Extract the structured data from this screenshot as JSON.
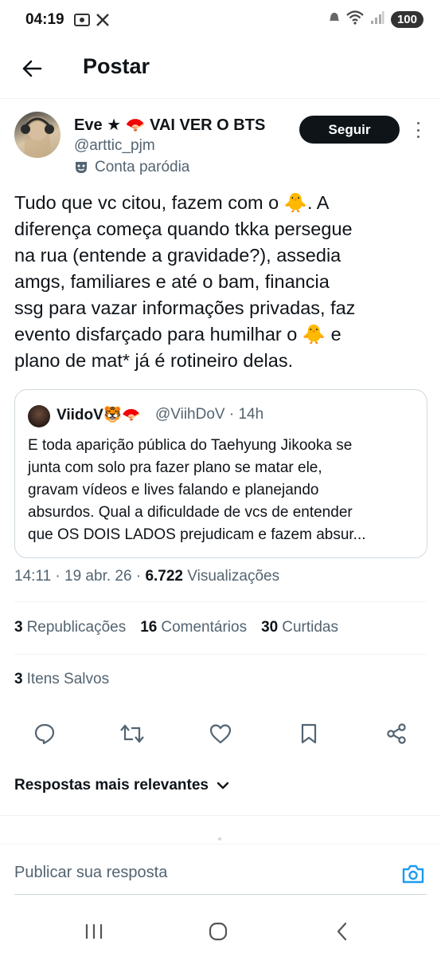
{
  "status_bar": {
    "time": "04:19",
    "battery": "100",
    "left_icons": [
      "screenshot-icon",
      "x-logo-icon"
    ],
    "right_icons": [
      "alarm-icon",
      "wifi-icon",
      "signal-icon"
    ]
  },
  "header": {
    "title": "Postar",
    "back_icon": "arrow-left-icon"
  },
  "post": {
    "author_name": "Eve ★ 🪭 VAI VER O BTS",
    "author_handle": "@arttic_pjm",
    "parody_label": "Conta paródia",
    "follow_label": "Seguir",
    "text_lines": [
      "Tudo que vc citou, fazem com o 🐥. A",
      "diferença começa quando tkka persegue",
      "na rua (entende a gravidade?), assedia",
      "amgs, familiares e até o bam, financia",
      "ssg para vazar informações privadas, faz",
      "evento disfarçado para humilhar o 🐥 e",
      "plano de mat* já é rotineiro delas."
    ],
    "quote": {
      "name": "ViidoV🐯🪭",
      "handle_time": "@ViihDoV · 14h",
      "text_lines": [
        "E toda aparição pública do Taehyung Jikooka se",
        "junta com solo pra fazer plano se matar ele,",
        "gravam vídeos e lives falando e planejando",
        "absurdos. Qual a dificuldade de vcs de entender",
        "que OS DOIS LADOS prejudicam e fazem absur..."
      ]
    },
    "meta": {
      "time_date": "14:11 · 19 abr. 26 · ",
      "views_count": "6.722",
      "views_label": " Visualizações"
    },
    "stats": {
      "reposts_count": "3",
      "reposts_label": "Republicações",
      "comments_count": "16",
      "comments_label": "Comentários",
      "likes_count": "30",
      "likes_label": "Curtidas",
      "saved_count": "3",
      "saved_label": "Itens Salvos"
    },
    "actions": [
      "reply-icon",
      "repost-icon",
      "like-icon",
      "bookmark-icon",
      "share-icon"
    ]
  },
  "replies": {
    "sort_label": "Respostas mais relevantes"
  },
  "composer": {
    "placeholder": "Publicar sua resposta"
  },
  "colors": {
    "text": "#0f1419",
    "secondary": "#536471",
    "accent": "#1d9bf0",
    "border": "#cfd9de"
  }
}
